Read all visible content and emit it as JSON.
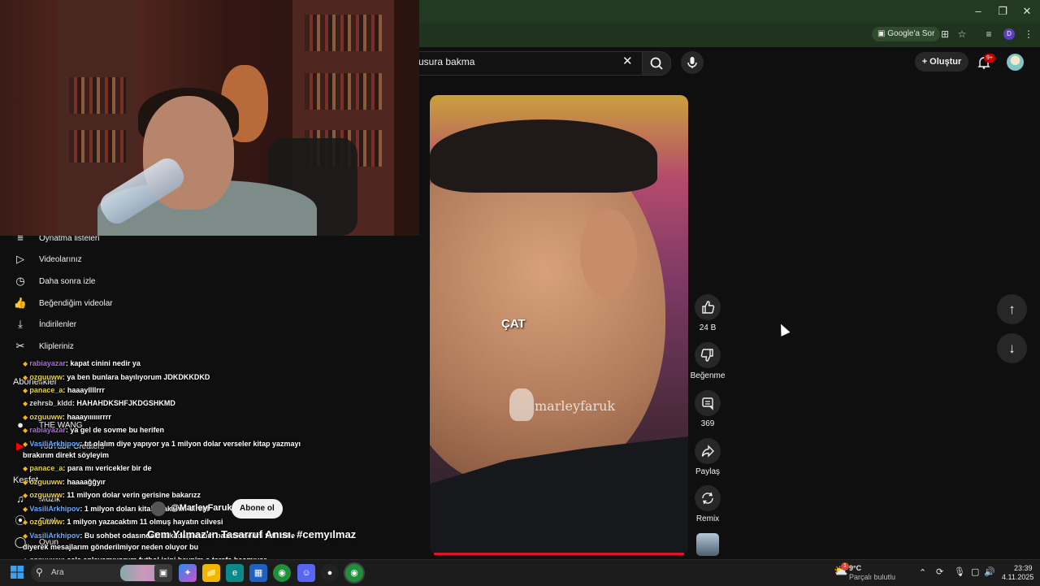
{
  "browser": {
    "google_sor": "Google'a Sor",
    "profile_letter": "D"
  },
  "header": {
    "search_value": "usura bakma",
    "create_label": "Oluştur",
    "notif_badge": "9+"
  },
  "sidebar": {
    "items": [
      {
        "label": "Oynatma listeleri",
        "icon": "playlist-icon"
      },
      {
        "label": "Videolarınız",
        "icon": "video-icon"
      },
      {
        "label": "Daha sonra izle",
        "icon": "clock-icon"
      },
      {
        "label": "Beğendiğim videolar",
        "icon": "thumbs-up-icon"
      },
      {
        "label": "İndirilenler",
        "icon": "download-icon"
      },
      {
        "label": "Klipleriniz",
        "icon": "scissors-icon"
      }
    ],
    "subscriptions_heading": "Abonelikler",
    "subscriptions": [
      {
        "label": "THE WANG"
      },
      {
        "label": "YouTube Creators"
      }
    ],
    "explore_heading": "Keşfet",
    "explore": [
      {
        "label": "Müzik"
      },
      {
        "label": "Canlı"
      },
      {
        "label": "Oyun"
      }
    ]
  },
  "chat": [
    {
      "user": "rabiayazar",
      "msg": ": kapat cinini nedir ya"
    },
    {
      "user": "ozguuww",
      "msg": ": ya ben bunlara bayılıyorum JDKDKKDKD"
    },
    {
      "user": "panace_a",
      "msg": ": haaayllllrrr"
    },
    {
      "user": "zehrsb_kldd",
      "msg": ": HAHAHDKSHFJKDGSHKMD"
    },
    {
      "user": "ozguuww",
      "msg": ": haaayıııııırrrr"
    },
    {
      "user": "rabiayazar",
      "msg": ": ya gel de sovme bu herifen"
    },
    {
      "user": "VasiliArkhipov",
      "msg": ": tıt olalım diye yapıyor ya 1 milyon dolar verseler kitap yazmayı"
    },
    {
      "user": "",
      "msg": "bırakırım direkt söyleyim"
    },
    {
      "user": "panace_a",
      "msg": ": para mı vericekler bir de"
    },
    {
      "user": "ozguuww",
      "msg": ": haaaağğyır"
    },
    {
      "user": "ozguuww",
      "msg": ": 11 milyon dolar verin gerisine bakarızz"
    },
    {
      "user": "VasiliArkhipov",
      "msg": ": 1 milyon doları kitabı yakarım direkt"
    },
    {
      "user": "ozguuww",
      "msg": ": 1 milyon yazacaktım 11 olmuş hayatın cilvesi"
    },
    {
      "user": "VasiliArkhipov",
      "msg": ": Bu sohbet odasındaki arkadaşlarımın bazı fikirlerini tatlı dille"
    },
    {
      "user": "",
      "msg": "diyerek mesajlarım gönderilmiyor neden oluyor bu"
    },
    {
      "user": "ozguuww",
      "msg": ": asla anlayamıyorum futbol işini beynim o tarafa basmıyor"
    }
  ],
  "video": {
    "caption": "ÇAT",
    "watermark": "marleyfaruk",
    "channel": "@MarleyFaruk",
    "subscribe_label": "Abone ol",
    "title": "Cem Yılmaz'ın Tasarruf Anısı. #cemyılmaz"
  },
  "actions": {
    "like_count": "24 B",
    "dislike_label": "Beğenme",
    "comment_count": "369",
    "share_label": "Paylaş",
    "remix_label": "Remix"
  },
  "taskbar": {
    "search_placeholder": "Ara",
    "weather_temp": "9°C",
    "weather_desc": "Parçalı bulutlu",
    "weather_badge": "1",
    "time": "23:39",
    "date": "4.11.2025"
  },
  "colors": {
    "browser_frame": "#233a22",
    "youtube_bg": "#0f0f0f",
    "progress_red": "#e3122b"
  }
}
